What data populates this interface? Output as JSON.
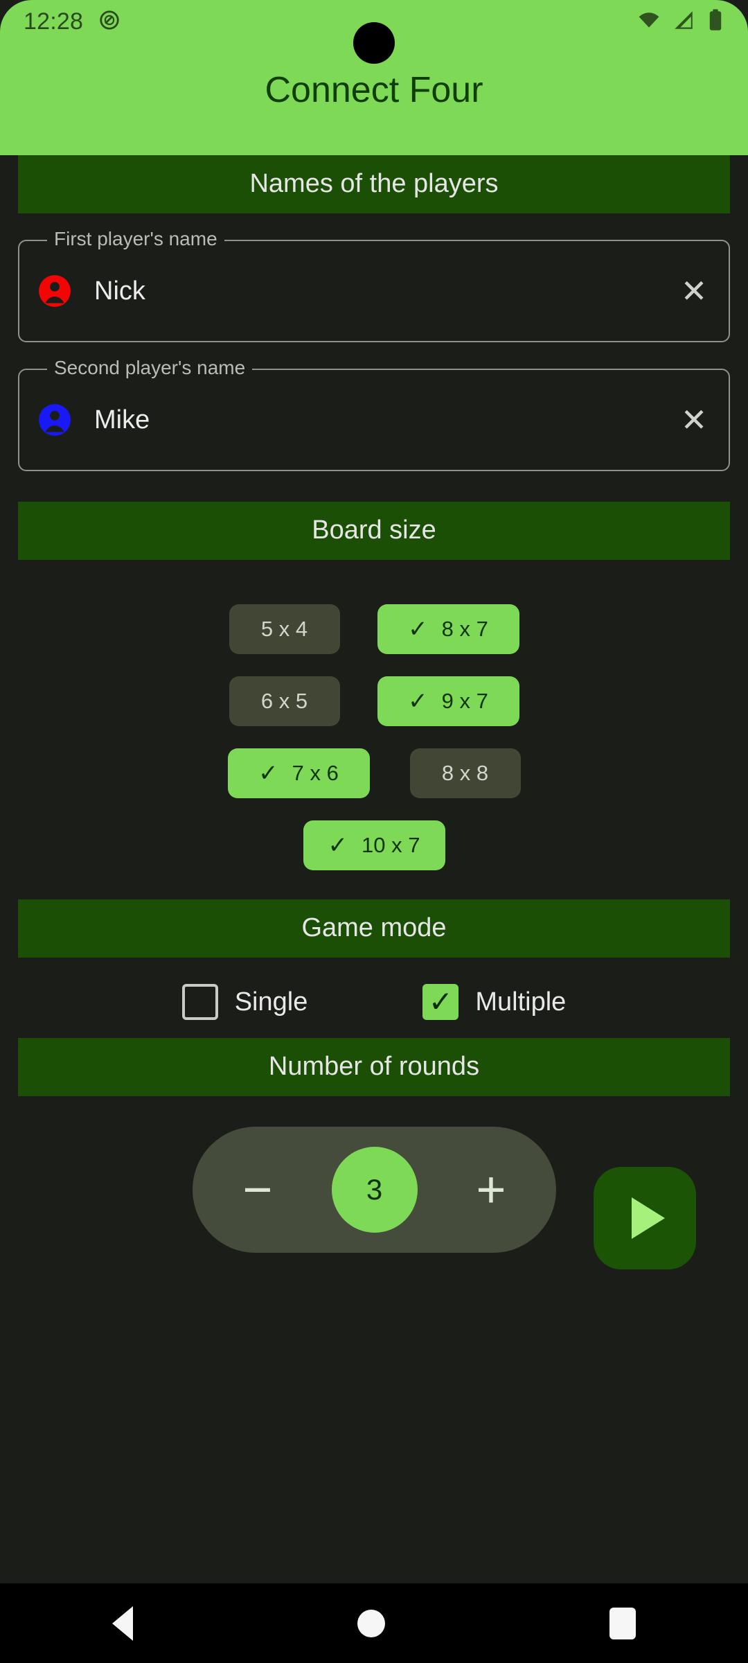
{
  "status_bar": {
    "time": "12:28",
    "icons": [
      "do-not-disturb-icon",
      "wifi-icon",
      "signal-icon",
      "battery-icon"
    ]
  },
  "app": {
    "title": "Connect Four",
    "header_bg": "#7ed957",
    "page_bg": "#1b1d19",
    "section_bg": "#1c4f06",
    "accent": "#7ed957"
  },
  "players_section": {
    "header": "Names of the players",
    "fields": [
      {
        "label": "First player's name",
        "value": "Nick",
        "avatar_color": "#f20505",
        "clear_label": "✕"
      },
      {
        "label": "Second player's name",
        "value": "Mike",
        "avatar_color": "#1919f5",
        "clear_label": "✕"
      }
    ]
  },
  "board_section": {
    "header": "Board size",
    "tick": "✓",
    "rows": [
      [
        {
          "label": "5 x 4",
          "selected": false
        },
        {
          "label": "8 x 7",
          "selected": true
        }
      ],
      [
        {
          "label": "6 x 5",
          "selected": false
        },
        {
          "label": "9 x 7",
          "selected": true
        }
      ],
      [
        {
          "label": "7 x 6",
          "selected": true
        },
        {
          "label": "8 x 8",
          "selected": false
        }
      ],
      [
        {
          "label": "10 x 7",
          "selected": true
        }
      ]
    ]
  },
  "mode_section": {
    "header": "Game mode",
    "check_glyph": "✓",
    "options": [
      {
        "label": "Single",
        "checked": false
      },
      {
        "label": "Multiple",
        "checked": true
      }
    ]
  },
  "rounds_section": {
    "header": "Number of rounds",
    "decrement_label": "−",
    "value": "3",
    "increment_label": "+",
    "play_label": "play-triangle"
  },
  "nav_bar": {
    "back": "back-icon",
    "home": "home-icon",
    "recents": "recents-icon"
  }
}
